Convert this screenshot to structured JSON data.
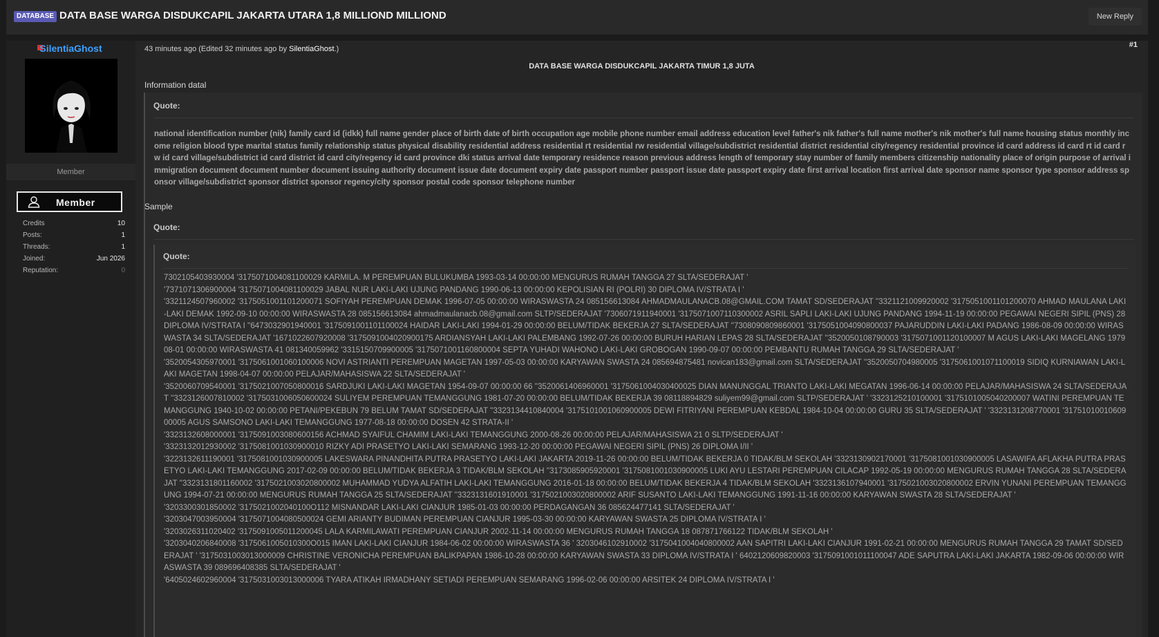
{
  "thread": {
    "tag": "DATABASE",
    "title": "DATA BASE WARGA DISDUKCAPIL JAKARTA UTARA 1,8 MILLIOND MILLIOND",
    "new_reply_label": "New Reply"
  },
  "user": {
    "name": "SilentiaGhost",
    "role": "Member",
    "badge_label": "Member",
    "stats": [
      {
        "label": "Credits",
        "value": "10"
      },
      {
        "label": "Posts:",
        "value": "1"
      },
      {
        "label": "Threads:",
        "value": "1"
      },
      {
        "label": "Joined:",
        "value": "Jun 2026"
      },
      {
        "label": "Reputation:",
        "value": "0"
      }
    ]
  },
  "post": {
    "time": "43 minutes ago (Edited 32 minutes ago by",
    "edited_by": "SilentiaGhost",
    "time_suffix": ".)",
    "number": "#1",
    "heading": "DATA BASE WARGA DISDUKCAPIL JAKARTA TIMUR 1,8 JUTA",
    "info_label": "Information datal",
    "quote_label": "Quote:",
    "fields_text": "national identification number (nik) family card id (idkk) full name gender place of birth date of birth occupation age mobile phone number email address education level father's nik father's full name mother's nik mother's full name housing status monthly income religion blood type marital status family relationship status physical disability residential address residential rt residential rw residential village/subdistrict residential district residential city/regency residential province id card address id card rt id card rw id card village/subdistrict id card district id card city/regency id card province dki status arrival date temporary residence reason previous address length of temporary stay number of family members citizenship nationality place of origin purpose of arrival immigration document document number document issuing authority document issue date document expiry date passport number passport issue date passport expiry date first arrival location first arrival date sponsor name sponsor type sponsor address sponsor village/subdistrict sponsor district sponsor regency/city sponsor postal code sponsor telephone number",
    "sample_label": "Sample",
    "sample_lines": [
      "7302105403930004 '3175071004081100029 KARMILA. M PEREMPUAN BULUKUMBA 1993-03-14 00:00:00 MENGURUS RUMAH TANGGA 27 SLTA/SEDERAJAT '",
      "'7371071306900004 '3175071004081100029 JABAL NUR LAKI-LAKI UJUNG PANDANG 1990-06-13 00:00:00 KEPOLISIAN RI (POLRI) 30 DIPLOMA IV/STRATA I '",
      "'3321124507960002 '3175051001101200071 SOFIYAH PEREMPUAN DEMAK 1996-07-05 00:00:00 WIRASWASTA 24 085156613084 AHMADMAULANACB.08@GMAIL.COM TAMAT SD/SEDERAJAT ''3321121009920002 '3175051001101200070 AHMAD MAULANA LAKI-LAKI DEMAK 1992-09-10 00:00:00 WIRASWASTA 28 085156613084 ahmadmaulanacb.08@gmail.com SLTP/SEDERAJAT '7306071911940001 '3175071007110300002 ASRIL SAPLI LAKI-LAKI UJUNG PANDANG 1994-11-19 00:00:00 PEGAWAI NEGERI SIPIL (PNS) 28 DIPLOMA IV/STRATA I ''6473032901940001 '3175091001101100024 HAIDAR LAKI-LAKI 1994-01-29 00:00:00 BELUM/TIDAK BEKERJA 27 SLTA/SEDERAJAT ''7308090809860001 '3175051004090800037 PAJARUDDIN LAKI-LAKI PADANG 1986-08-09 00:00:00 WIRASWASTA 34 SLTA/SEDERAJAT '1671022607920008 '3175091004020900175 ARDIANSYAH LAKI-LAKI PALEMBANG 1992-07-26 00:00:00 BURUH HARIAN LEPAS 28 SLTA/SEDERAJAT ''3520050108790003 '3175071001120100007 M AGUS LAKI-LAKI MAGELANG 197908-01 00:00:00 WIRASWASTA 41 081340059962 '3315150709900005 '3175071001160800004 SEPTA YUHADI WAHONO LAKI-LAKI GROBOGAN 1990-09-07 00:00:00 PEMBANTU RUMAH TANGGA 29 SLTA/SEDERAJAT '",
      "'3520054305970001 '3175061001060100006 NOVI ASTRIANTI PEREMPUAN MAGETAN 1997-05-03 00:00:00 KARYAWAN SWASTA 24 085694875481 novican183@gmail.com SLTA/SEDERAJAT ''3520050704980005 '3175061001071100019 SIDIQ KURNIAWAN LAKI-LAKI MAGETAN 1998-04-07 00:00:00 PELAJAR/MAHASISWA 22 SLTA/SEDERAJAT '",
      "'3520060709540001 '3175021007050800016 SARDJUKI LAKI-LAKI MAGETAN 1954-09-07 00:00:00 66 ''3520061406960001 '3175061004030400025 DIAN MANUNGGAL TRIANTO LAKI-LAKI MEGATAN 1996-06-14 00:00:00 PELAJAR/MAHASISWA 24 SLTA/SEDERAJAT ''3323126007810002 '3175031006050600024 SULIYEM PEREMPUAN TEMANGGUNG 1981-07-20 00:00:00 BELUM/TIDAK BEKERJA 39 08118894829 suliyem99@gmail.com SLTP/SEDERAJAT ' '3323125210100001 '3175101005040200007 WATINI PEREMPUAN TEMANGGUNG 1940-10-02 00:00:00 PETANI/PEKEBUN 79 BELUM TAMAT SD/SEDERAJAT ''3323134410840004 '3175101001060900005 DEWI FITRIYANI PEREMPUAN KEBDAL 1984-10-04 00:00:00 GURU 35 SLTA/SEDERAJAT ' '3323131208770001 '3175101001060900005 AGUS SAMSONO LAKI-LAKI TEMANGGUNG 1977-08-18 00:00:00 DOSEN 42 STRATA-II '",
      "'3323132608000001 '3175091003080600156 ACHMAD SYAIFUL CHAMIM LAKI-LAKI TEMANGGUNG 2000-08-26 00:00:00 PELAJAR/MAHASISWA 21 0 SLTP/SEDERAJAT '",
      "'3323132012930002 '3175081001030900010 RIZKY ADI PRASETYO LAKI-LAKI SEMARANG 1993-12-20 00:00:00 PEGAWAI NEGERI SIPIL (PNS) 26 DIPLOMA I/II '",
      "'3223132611190001 '3175081001030900005 LAKESWARA PINANDHITA PUTRA PRASETYO LAKI-LAKI JAKARTA 2019-11-26 00:00:00 BELUM/TIDAK BEKERJA 0 TIDAK/BLM SEKOLAH '3323130902170001 '3175081001030900005 LASAWIFA AFLAKHA PUTRA PRASETYO LAKI-LAKI TEMANGGUNG 2017-02-09 00:00:00 BELUM/TIDAK BEKERJA 3 TIDAK/BLM SEKOLAH ''3173085905920001 '3175081001030900005 LUKI AYU LESTARI PEREMPUAN CILACAP 1992-05-19 00:00:00 MENGURUS RUMAH TANGGA 28 SLTA/SEDERAJAT ''3323131801160002 '3175021003020800002 MUHAMMAD YUDYA ALFATIH LAKI-LAKI TEMANGGUNG 2016-01-18 00:00:00 BELUM/TIDAK BEKERJA 4 TIDAK/BLM SEKOLAH '3323136107940001 '3175021003020800002 ERVIN YUNANI PEREMPUAN TEMANGGUNG 1994-07-21 00:00:00 MENGURUS RUMAH TANGGA 25 SLTA/SEDERAJAT ''3323131601910001 '3175021003020800002 ARIF SUSANTO LAKI-LAKI TEMANGGUNG 1991-11-16 00:00:00 KARYAWAN SWASTA 28 SLTA/SEDERAJAT '",
      "'3203300301850002 '3175021002040100O112 MISNANDAR LAKI-LAKI CIANJUR 1985-01-03 00:00:00 PERDAGANGAN 36 085624477141 SLTA/SEDERAJAT '",
      "'3203047003950004 '3175071004080500024 GEMI ARIANTY BUDIMAN PEREMPUAN CIANJUR 1995-03-30 00:00:00 KARYAWAN SWASTA 25 DIPLOMA IV/STRATA I '",
      "'3203026311020402 '3175091005011200045 LALA KARMILAWATI PEREMPUAN CIANJUR 2002-11-14 00:00:00 MENGURUS RUMAH TANGGA 18 087871766122 TIDAK/BLM SEKOLAH '",
      "'3203040206840008 '3175061005010300O015 IMAN LAKI-LAKI CIANJUR 1984-06-02 00:00:00 WIRASWASTA 36 ' 3203046102910002 '3175041004040800002 AAN SAPITRI LAKI-LAKI CIANJUR 1991-02-21 00:00:00 MENGURUS RUMAH TANGGA 29 TAMAT SD/SEDERAJAT ' '3175031003013000009 CHRISTINE VERONICHA PEREMPUAN BALIKPAPAN 1986-10-28 00:00:00 KARYAWAN SWASTA 33 DIPLOMA IV/STRATA I ' 6402120609820003 '3175091001011100047 ADE SAPUTRA LAKI-LAKI JAKARTA 1982-09-06 00:00:00 WIRASWASTA 39 089696408385 SLTA/SEDERAJAT '",
      "'6405024602960004 '3175031003013000006 TYARA ATIKAH IRMADHANY SETIADI PEREMPUAN SEMARANG 1996-02-06 00:00:00 ARSITEK 24 DIPLOMA IV/STRATA I '"
    ]
  }
}
